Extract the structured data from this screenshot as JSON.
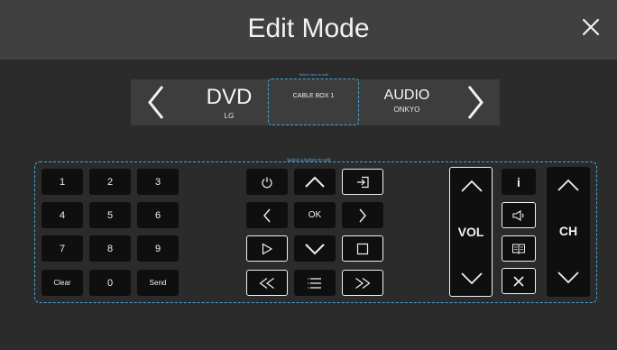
{
  "header": {
    "title": "Edit Mode"
  },
  "devices": {
    "left": {
      "name": "DVD",
      "brand": "LG"
    },
    "selected": {
      "hint": "Select here to edit",
      "name": "CABLE BOX 1"
    },
    "right": {
      "name": "AUDIO",
      "brand": "ONKYO"
    }
  },
  "edit_area_hint": "Select a button to edit",
  "numpad": [
    "1",
    "2",
    "3",
    "4",
    "5",
    "6",
    "7",
    "8",
    "9",
    "Clear",
    "0",
    "Send"
  ],
  "nav": {
    "ok_label": "OK"
  },
  "volume": {
    "label": "VOL"
  },
  "channel": {
    "label": "CH"
  },
  "mid": {
    "info_label": "i"
  },
  "colors": {
    "accent": "#4aa3d8",
    "background": "#2b2b2b",
    "header": "#404040",
    "button": "#0f0f0f"
  }
}
